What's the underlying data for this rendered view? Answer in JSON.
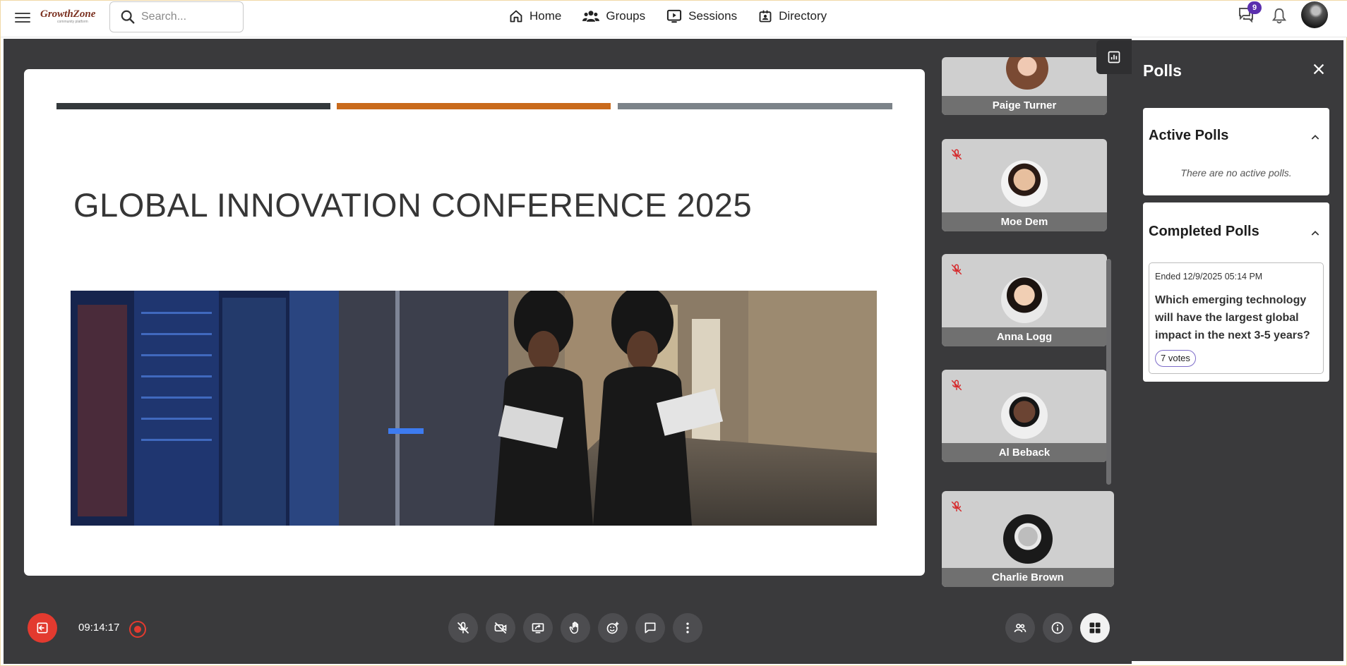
{
  "header": {
    "logo_text": "GrowthZone",
    "logo_sub": "community platform",
    "search_placeholder": "Search...",
    "nav": [
      {
        "label": "Home",
        "icon": "home-icon"
      },
      {
        "label": "Groups",
        "icon": "groups-icon"
      },
      {
        "label": "Sessions",
        "icon": "sessions-icon"
      },
      {
        "label": "Directory",
        "icon": "directory-icon"
      }
    ],
    "notifications_count": "9"
  },
  "slide": {
    "title": "GLOBAL INNOVATION CONFERENCE 2025",
    "bar_colors": [
      "#34393c",
      "#c96a1c",
      "#7c8389"
    ]
  },
  "participants": [
    {
      "name": "Paige Turner",
      "muted": false
    },
    {
      "name": "Moe Dem",
      "muted": true
    },
    {
      "name": "Anna Logg",
      "muted": true
    },
    {
      "name": "Al Beback",
      "muted": true
    },
    {
      "name": "Charlie Brown",
      "muted": true
    }
  ],
  "polls": {
    "title": "Polls",
    "active": {
      "heading": "Active Polls",
      "empty_text": "There are no active polls."
    },
    "completed": {
      "heading": "Completed Polls",
      "items": [
        {
          "ended": "Ended 12/9/2025 05:14 PM",
          "question": "Which emerging technology will have the largest global impact in the next 3-5 years?",
          "votes": "7 votes"
        }
      ]
    }
  },
  "controls": {
    "timer": "09:14:17"
  },
  "colors": {
    "stage": "#3a3a3c",
    "accent": "#5b2fae",
    "danger": "#e33a2f"
  }
}
